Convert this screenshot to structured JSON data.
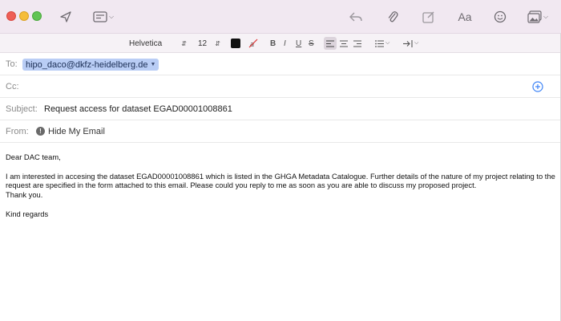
{
  "format_bar": {
    "font_name": "Helvetica",
    "font_size": "12",
    "text_color": "#111111",
    "bold": "B",
    "italic": "I",
    "underline": "U",
    "strike": "S"
  },
  "header": {
    "to_label": "To:",
    "to_recipient": "hipo_daco@dkfz-heidelberg.de",
    "cc_label": "Cc:",
    "subject_label": "Subject:",
    "subject_value": "Request access for dataset EGAD00001008861",
    "from_label": "From:",
    "from_icon_glyph": "!",
    "from_value": "Hide My Email"
  },
  "toolbar": {
    "icons": [
      "send-icon",
      "header-fields-icon",
      "reply-icon",
      "attach-icon",
      "markup-icon",
      "format-text-icon",
      "emoji-icon",
      "photo-browser-icon"
    ],
    "format_label": "Aa"
  },
  "colors": {
    "titlebar_bg": "#f1e8f1",
    "recipient_bg": "#b9cdf5",
    "accent": "#3b82f6"
  },
  "body": {
    "greeting": "Dear DAC team,",
    "paragraph": "I am interested in accesing the dataset EGAD00001008861 which is listed in the GHGA Metadata Catalogue. Further details of the nature of my project relating to the request are specified in the form attached to this email. Please could you reply to me as soon as you are able to discuss my proposed project.",
    "thanks": "Thank you.",
    "closing": "Kind regards"
  }
}
